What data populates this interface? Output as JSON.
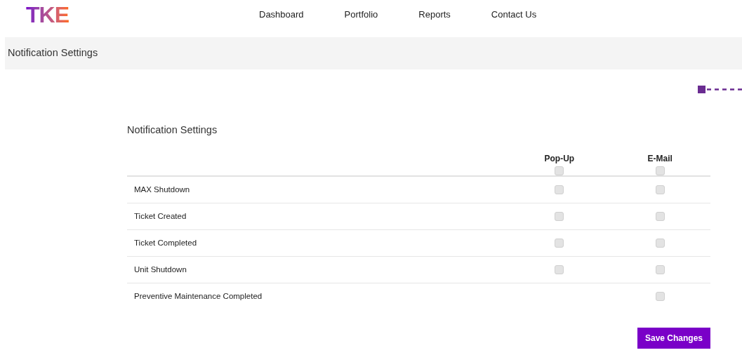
{
  "logo": "TKE",
  "nav": [
    "Dashboard",
    "Portfolio",
    "Reports",
    "Contact Us"
  ],
  "page_title": "Notification Settings",
  "section_title": "Notification Settings",
  "columns": [
    {
      "label": "Pop-Up",
      "checked": false
    },
    {
      "label": "E-Mail",
      "checked": false
    }
  ],
  "rows": [
    {
      "label": "MAX Shutdown",
      "popup": {
        "checked": false
      },
      "email": {
        "checked": false
      }
    },
    {
      "label": "Ticket Created",
      "popup": {
        "checked": false
      },
      "email": {
        "checked": false
      }
    },
    {
      "label": "Ticket Completed",
      "popup": {
        "checked": false
      },
      "email": {
        "checked": false
      }
    },
    {
      "label": "Unit Shutdown",
      "popup": {
        "checked": false
      },
      "email": {
        "checked": false
      }
    },
    {
      "label": "Preventive Maintenance Completed",
      "email": {
        "checked": false
      }
    }
  ],
  "save_button": "Save Changes"
}
